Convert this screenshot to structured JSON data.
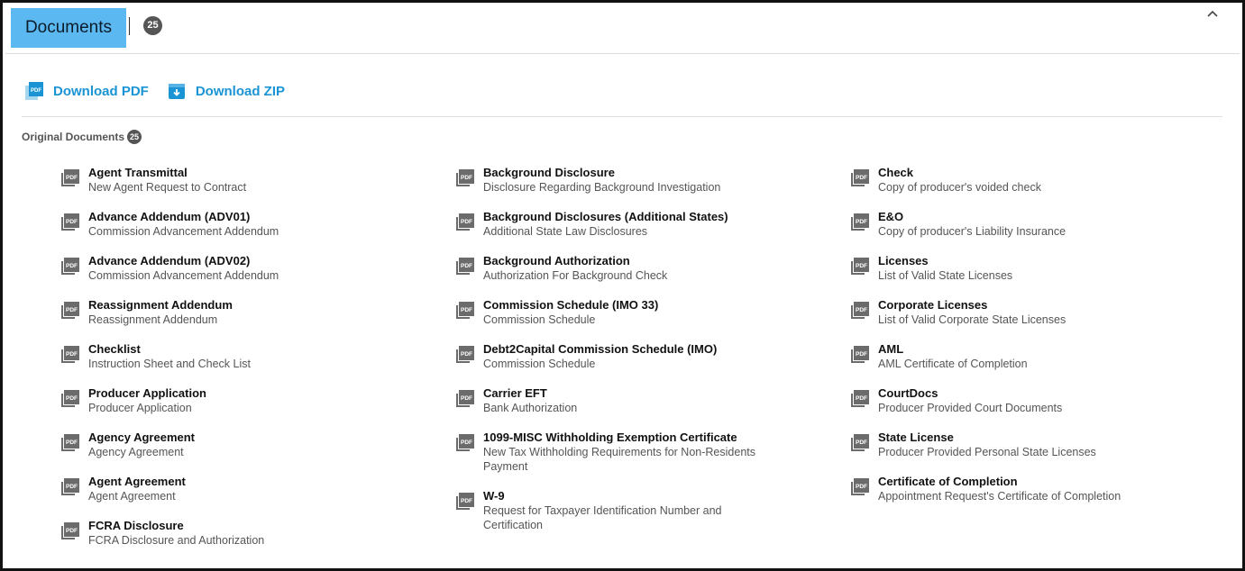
{
  "header": {
    "title": "Documents",
    "count": "25"
  },
  "toolbar": {
    "download_pdf": "Download PDF",
    "download_zip": "Download ZIP"
  },
  "section": {
    "label": "Original Documents",
    "count": "25"
  },
  "icons": {
    "doc": "pdf-file-icon",
    "download_pdf": "pdf-icon",
    "download_zip": "zip-download-icon",
    "collapse": "chevron-up-icon",
    "pdf_text": "PDF"
  },
  "colors": {
    "accent": "#1a94d4",
    "title_bg": "#5bb8f0",
    "badge": "#555555"
  },
  "documents": {
    "col1": [
      {
        "title": "Agent Transmittal",
        "subtitle": "New Agent Request to Contract"
      },
      {
        "title": "Advance Addendum (ADV01)",
        "subtitle": "Commission Advancement Addendum"
      },
      {
        "title": "Advance Addendum (ADV02)",
        "subtitle": "Commission Advancement Addendum"
      },
      {
        "title": "Reassignment Addendum",
        "subtitle": "Reassignment Addendum"
      },
      {
        "title": "Checklist",
        "subtitle": "Instruction Sheet and Check List"
      },
      {
        "title": "Producer Application",
        "subtitle": "Producer Application"
      },
      {
        "title": "Agency Agreement",
        "subtitle": "Agency Agreement"
      },
      {
        "title": "Agent Agreement",
        "subtitle": "Agent Agreement"
      },
      {
        "title": "FCRA Disclosure",
        "subtitle": "FCRA Disclosure and Authorization"
      }
    ],
    "col2": [
      {
        "title": "Background Disclosure",
        "subtitle": "Disclosure Regarding Background Investigation"
      },
      {
        "title": "Background Disclosures (Additional States)",
        "subtitle": "Additional State Law Disclosures"
      },
      {
        "title": "Background Authorization",
        "subtitle": "Authorization For Background Check"
      },
      {
        "title": "Commission Schedule (IMO 33)",
        "subtitle": "Commission Schedule"
      },
      {
        "title": "Debt2Capital Commission Schedule (IMO)",
        "subtitle": "Commission Schedule"
      },
      {
        "title": "Carrier EFT",
        "subtitle": "Bank Authorization"
      },
      {
        "title": "1099-MISC Withholding Exemption Certificate",
        "subtitle": "New Tax Withholding Requirements for Non-Residents Payment"
      },
      {
        "title": "W-9",
        "subtitle": "Request for Taxpayer Identification Number and Certification"
      }
    ],
    "col3": [
      {
        "title": "Check",
        "subtitle": "Copy of producer's voided check"
      },
      {
        "title": "E&O",
        "subtitle": "Copy of producer's Liability Insurance"
      },
      {
        "title": "Licenses",
        "subtitle": "List of Valid State Licenses"
      },
      {
        "title": "Corporate Licenses",
        "subtitle": "List of Valid Corporate State Licenses"
      },
      {
        "title": "AML",
        "subtitle": "AML Certificate of Completion"
      },
      {
        "title": "CourtDocs",
        "subtitle": "Producer Provided Court Documents"
      },
      {
        "title": "State License",
        "subtitle": "Producer Provided Personal State Licenses"
      },
      {
        "title": "Certificate of Completion",
        "subtitle": "Appointment Request's Certificate of Completion"
      }
    ]
  }
}
